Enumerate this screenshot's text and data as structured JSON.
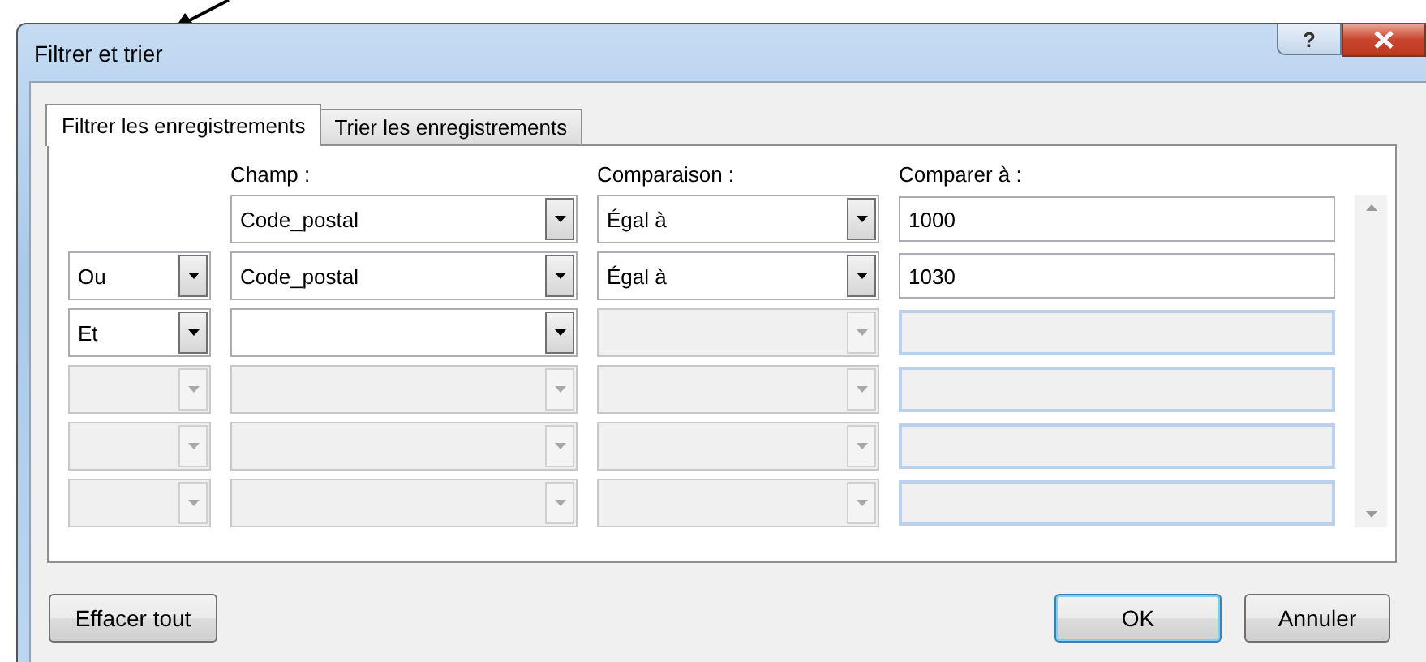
{
  "window": {
    "title": "Filtrer et trier",
    "help_button": "?"
  },
  "tabs": [
    {
      "label": "Filtrer les enregistrements",
      "selected": true
    },
    {
      "label": "Trier les enregistrements",
      "selected": false
    }
  ],
  "columns": {
    "field": "Champ :",
    "comparison": "Comparaison :",
    "compare_to": "Comparer à :"
  },
  "rows": [
    {
      "field": {
        "value": "Code_postal",
        "disabled": false
      },
      "comparison": {
        "value": "Égal à",
        "disabled": false
      },
      "compare_to": {
        "value": "1000",
        "disabled": false
      }
    },
    {
      "connector": {
        "value": "Ou",
        "disabled": false
      },
      "field": {
        "value": "Code_postal",
        "disabled": false
      },
      "comparison": {
        "value": "Égal à",
        "disabled": false
      },
      "compare_to": {
        "value": "1030",
        "disabled": false
      }
    },
    {
      "connector": {
        "value": "Et",
        "disabled": false
      },
      "field": {
        "disabled": false
      },
      "comparison": {
        "disabled": true
      },
      "compare_to": {
        "disabled": true
      }
    },
    {
      "connector": {
        "disabled": true
      },
      "field": {
        "disabled": true
      },
      "comparison": {
        "disabled": true
      },
      "compare_to": {
        "disabled": true
      }
    },
    {
      "connector": {
        "disabled": true
      },
      "field": {
        "disabled": true
      },
      "comparison": {
        "disabled": true
      },
      "compare_to": {
        "disabled": true
      }
    },
    {
      "connector": {
        "disabled": true
      },
      "field": {
        "disabled": true
      },
      "comparison": {
        "disabled": true
      },
      "compare_to": {
        "disabled": true
      }
    }
  ],
  "buttons": [
    {
      "label": "Effacer tout",
      "kind": "clear"
    },
    {
      "label": "OK",
      "kind": "default"
    },
    {
      "label": "Annuler",
      "kind": "normal"
    }
  ]
}
